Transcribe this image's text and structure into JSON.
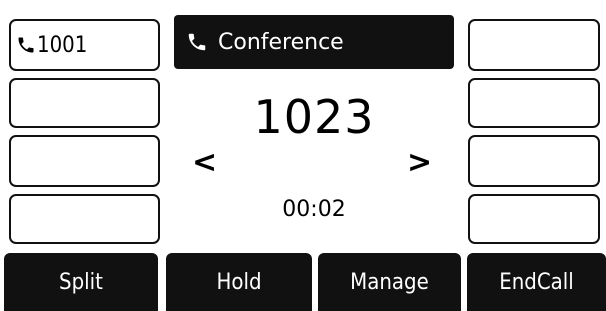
{
  "line_keys": {
    "left": [
      {
        "label": "1001",
        "icon": "phone-handset-icon"
      },
      {
        "label": ""
      },
      {
        "label": ""
      },
      {
        "label": ""
      }
    ],
    "right": [
      {
        "label": ""
      },
      {
        "label": ""
      },
      {
        "label": ""
      },
      {
        "label": ""
      }
    ]
  },
  "call": {
    "title": "Conference",
    "title_icon": "phone-handset-icon",
    "number": "1023",
    "duration": "00:02",
    "prev_arrow": "<",
    "next_arrow": ">"
  },
  "softkeys": [
    "Split",
    "Hold",
    "Manage",
    "EndCall"
  ],
  "colors": {
    "background": "#ffffff",
    "bar": "#111111",
    "bar_text": "#ffffff"
  }
}
